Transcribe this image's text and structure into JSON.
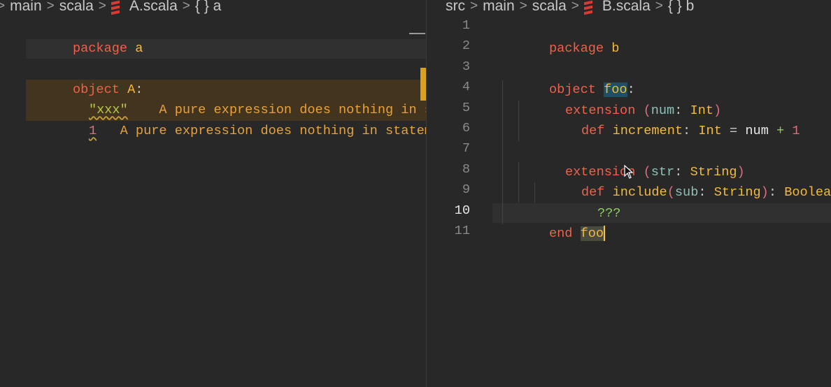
{
  "left_editor": {
    "breadcrumb": {
      "parts": [
        "main",
        "scala"
      ],
      "file": "A.scala",
      "symbol": "{ } a",
      "separator": ">"
    },
    "code": {
      "line1": {
        "kw": "package",
        "name": "a"
      },
      "line3": {
        "kw": "object",
        "name": "A",
        "punct": ":"
      },
      "line4": {
        "literal": "\"xxx\"",
        "diagnostic": "A pure expression does nothing in statement position"
      },
      "line5": {
        "literal": "1",
        "diagnostic": "A pure expression does nothing in statement position"
      }
    }
  },
  "right_editor": {
    "breadcrumb": {
      "parts": [
        "src",
        "main",
        "scala"
      ],
      "file": "B.scala",
      "symbol": "{ } b",
      "separator": ">"
    },
    "line_numbers": [
      "1",
      "2",
      "3",
      "4",
      "5",
      "6",
      "7",
      "8",
      "9",
      "10",
      "11"
    ],
    "active_line": "10",
    "code": {
      "l1": {
        "kw": "package",
        "name": "b"
      },
      "l3": {
        "kw": "object",
        "name": "foo",
        "punct": ":"
      },
      "l4": {
        "kw": "extension",
        "open": "(",
        "param": "num",
        "colon": ":",
        "type": "Int",
        "close": ")"
      },
      "l5": {
        "kw": "def",
        "name": "increment",
        "colon": ":",
        "type": "Int",
        "eq": "=",
        "ref": "num",
        "op": "+",
        "num": "1"
      },
      "l7": {
        "kw": "extension",
        "open": "(",
        "param": "str",
        "colon": ":",
        "type": "String",
        "close": ")"
      },
      "l8": {
        "kw": "def",
        "name": "include",
        "open": "(",
        "param": "sub",
        "colon": ":",
        "type": "String",
        "close": ")",
        "colon2": ":",
        "rtype": "Boolean",
        "eq": "="
      },
      "l9": {
        "body": "???"
      },
      "l10": {
        "kw": "end",
        "name": "foo"
      }
    }
  }
}
